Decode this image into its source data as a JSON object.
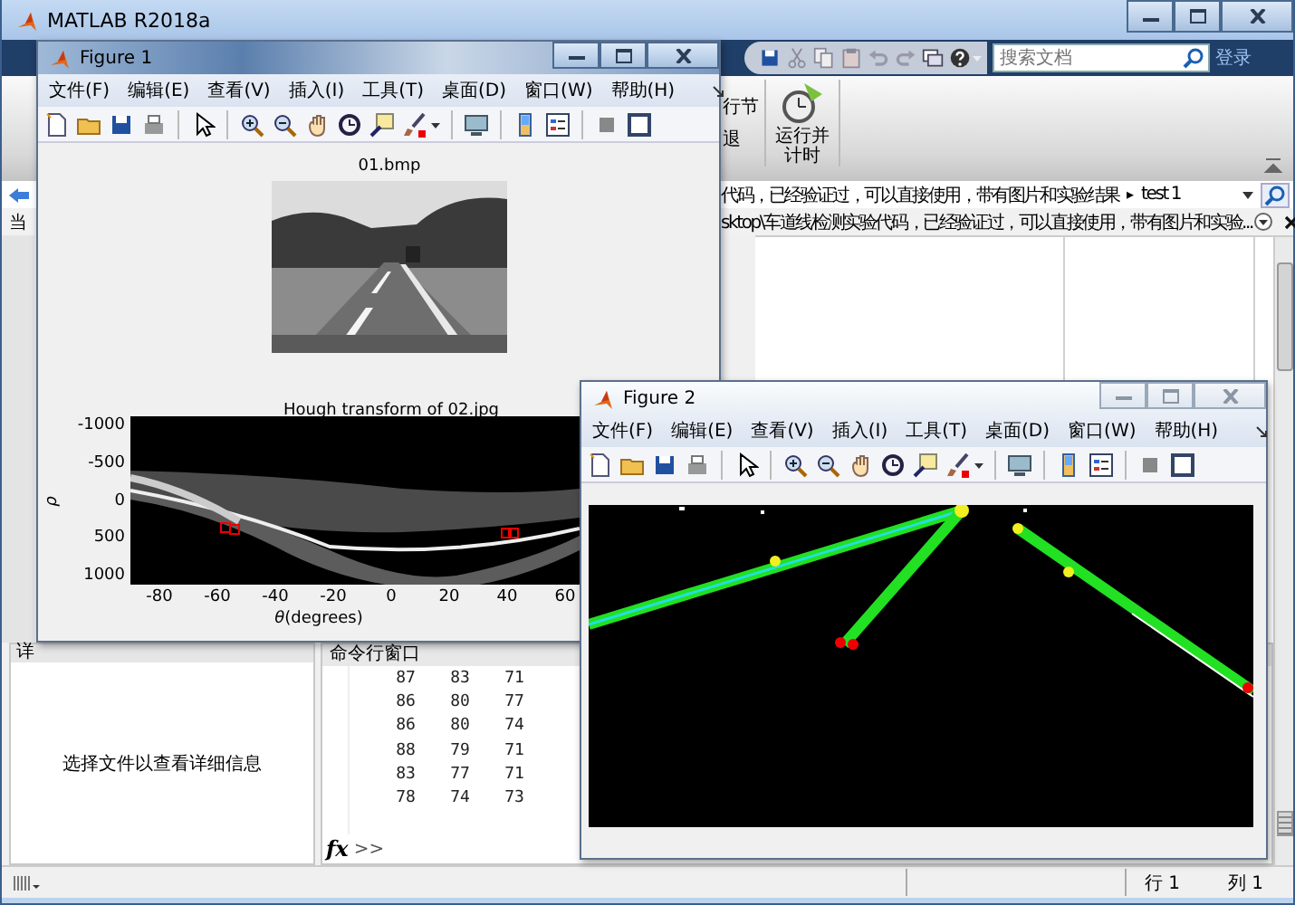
{
  "main_window": {
    "title": "MATLAB R2018a",
    "search": {
      "placeholder": "搜索文档"
    },
    "sign_in": "登录",
    "ribbon": {
      "section_fragments": [
        "行节",
        "退"
      ],
      "run_and_time": [
        "运行并",
        "计时"
      ]
    },
    "address_bar": {
      "path": "代码，已经验证过，可以直接使用，带有图片和实验结果",
      "separator": "▸",
      "folder": "test 1"
    },
    "current_folder": {
      "label_fragment": "当",
      "path": "sktop\\车道线检测实验代码，已经验证过，可以直接使用，带有图片和实验..."
    },
    "details_panel": {
      "title_fragment": "详",
      "message": "选择文件以查看详细信息"
    },
    "command_window": {
      "title": "命令行窗口",
      "rows": [
        [
          "87",
          "83",
          "71"
        ],
        [
          "86",
          "80",
          "77"
        ],
        [
          "86",
          "80",
          "74"
        ],
        [
          "88",
          "79",
          "71"
        ],
        [
          "83",
          "77",
          "71"
        ],
        [
          "78",
          "74",
          "73"
        ]
      ],
      "fx": "fx",
      "prompt": ">>"
    },
    "status_bar": {
      "row": "行 1",
      "column": "列 1"
    }
  },
  "figures": [
    {
      "title": "Figure 1",
      "active": true,
      "menu": [
        "文件(F)",
        "编辑(E)",
        "查看(V)",
        "插入(I)",
        "工具(T)",
        "桌面(D)",
        "窗口(W)",
        "帮助(H)"
      ],
      "axes": [
        {
          "title": "01.bmp"
        },
        {
          "kind": "hough",
          "title": "Hough transform of 02.jpg",
          "xticks": [
            "-80",
            "-60",
            "-40",
            "-20",
            "0",
            "20",
            "40",
            "60"
          ],
          "yticks": [
            "-1000",
            "-500",
            "0",
            "500",
            "1000"
          ],
          "xlabel": "*θ*(degrees)",
          "ylabel": "ρ"
        }
      ]
    },
    {
      "title": "Figure 2",
      "active": false,
      "menu": [
        "文件(F)",
        "编辑(E)",
        "查看(V)",
        "插入(I)",
        "工具(T)",
        "桌面(D)",
        "窗口(W)",
        "帮助(H)"
      ],
      "axes": [
        {
          "kind": "lines"
        }
      ]
    }
  ]
}
